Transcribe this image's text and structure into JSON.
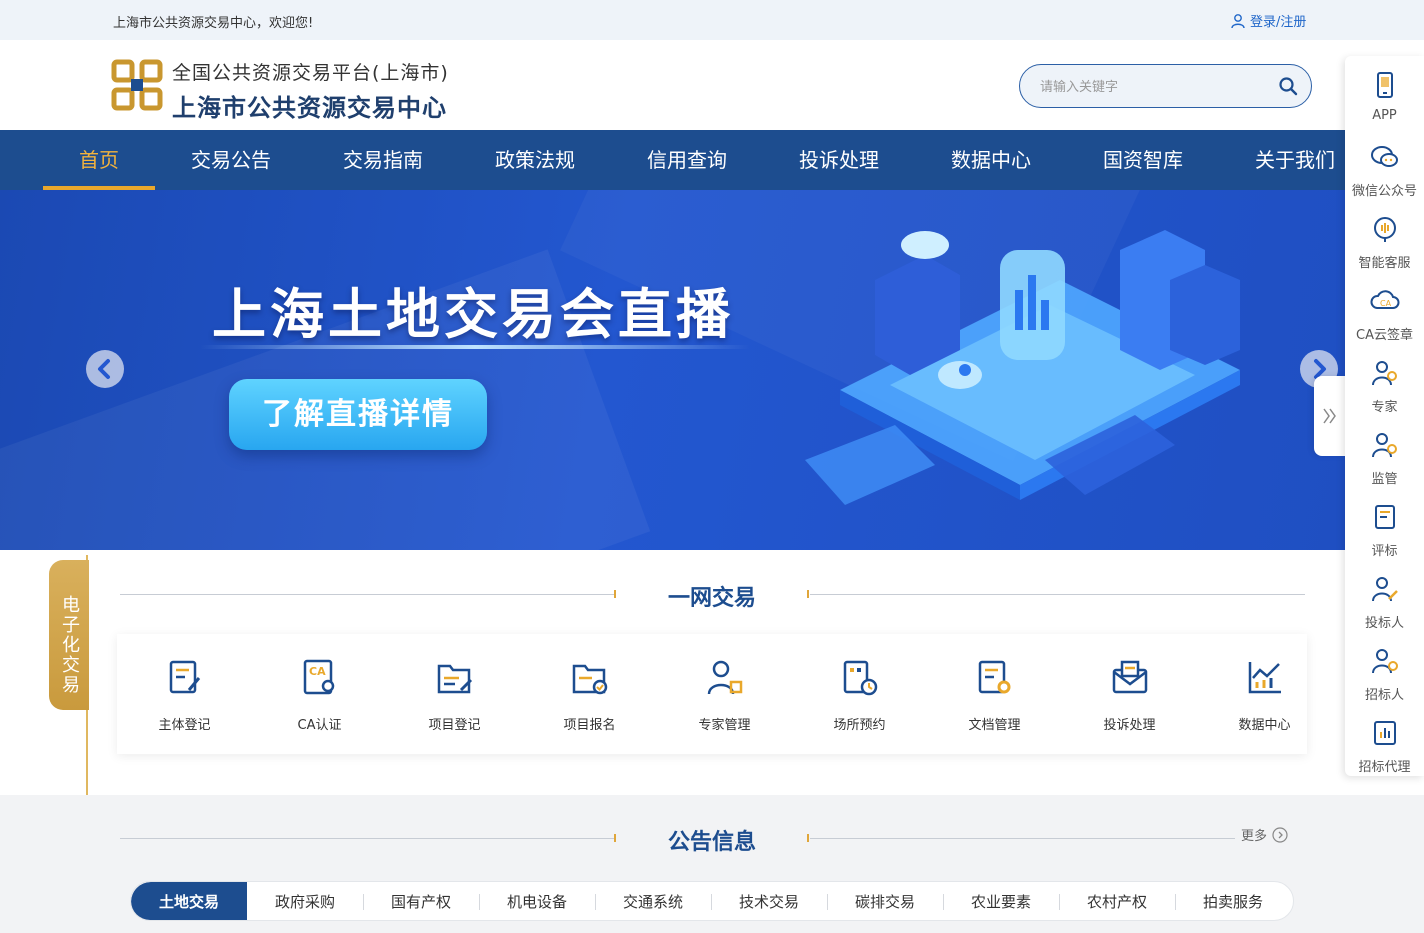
{
  "topbar": {
    "welcome": "上海市公共资源交易中心，欢迎您!",
    "login": "登录/注册"
  },
  "header": {
    "subtitle": "全国公共资源交易平台(上海市)",
    "title": "上海市公共资源交易中心",
    "search_placeholder": "请输入关键字"
  },
  "nav": [
    "首页",
    "交易公告",
    "交易指南",
    "政策法规",
    "信用查询",
    "投诉处理",
    "数据中心",
    "国资智库",
    "关于我们"
  ],
  "banner": {
    "title": "上海土地交易会直播",
    "button": "了解直播详情"
  },
  "rightbar": [
    "APP",
    "微信公众号",
    "智能客服",
    "CA云签章",
    "专家",
    "监管",
    "评标",
    "投标人",
    "招标人",
    "招标代理"
  ],
  "side_tab": "电子化交易",
  "section1": {
    "title": "一网交易"
  },
  "services": [
    "主体登记",
    "CA认证",
    "项目登记",
    "项目报名",
    "专家管理",
    "场所预约",
    "文档管理",
    "投诉处理",
    "数据中心"
  ],
  "section2": {
    "title": "公告信息",
    "more": "更多"
  },
  "tabs": [
    "土地交易",
    "政府采购",
    "国有产权",
    "机电设备",
    "交通系统",
    "技术交易",
    "碳排交易",
    "农业要素",
    "农村产权",
    "拍卖服务"
  ],
  "colors": {
    "navy": "#1d4d8f",
    "gold": "#e9a82b",
    "banner": "#2357d0"
  }
}
